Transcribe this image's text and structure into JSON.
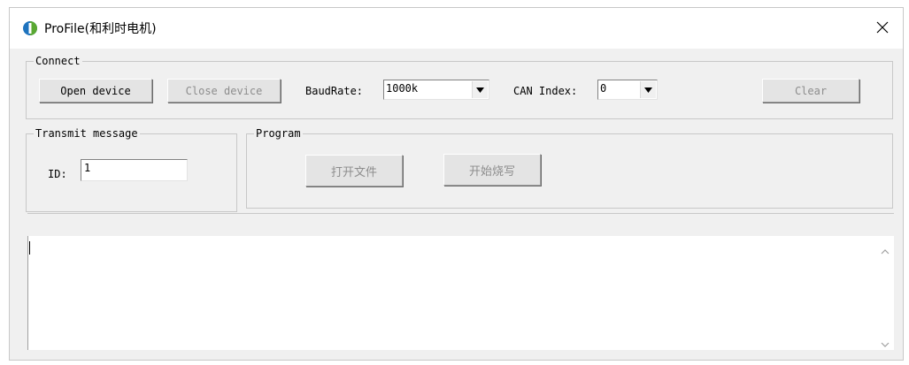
{
  "window": {
    "title": "ProFile(和利时电机)"
  },
  "connect": {
    "group_label": "Connect",
    "open_label": "Open device",
    "close_label": "Close device",
    "baudrate_label": "BaudRate:",
    "baudrate_value": "1000k",
    "can_index_label": "CAN Index:",
    "can_index_value": "0",
    "clear_label": "Clear"
  },
  "transmit": {
    "group_label": "Transmit message",
    "id_label": "ID:",
    "id_value": "1"
  },
  "program": {
    "group_label": "Program",
    "open_file_label": "打开文件",
    "start_burn_label": "开始烧写"
  },
  "log": {
    "text": ""
  },
  "colors": {
    "window_bg": "#f0f0f0",
    "border": "#c8c8c8",
    "disabled_text": "#8d8d8d",
    "icon_blue": "#1e73be",
    "icon_green": "#5aa832"
  }
}
